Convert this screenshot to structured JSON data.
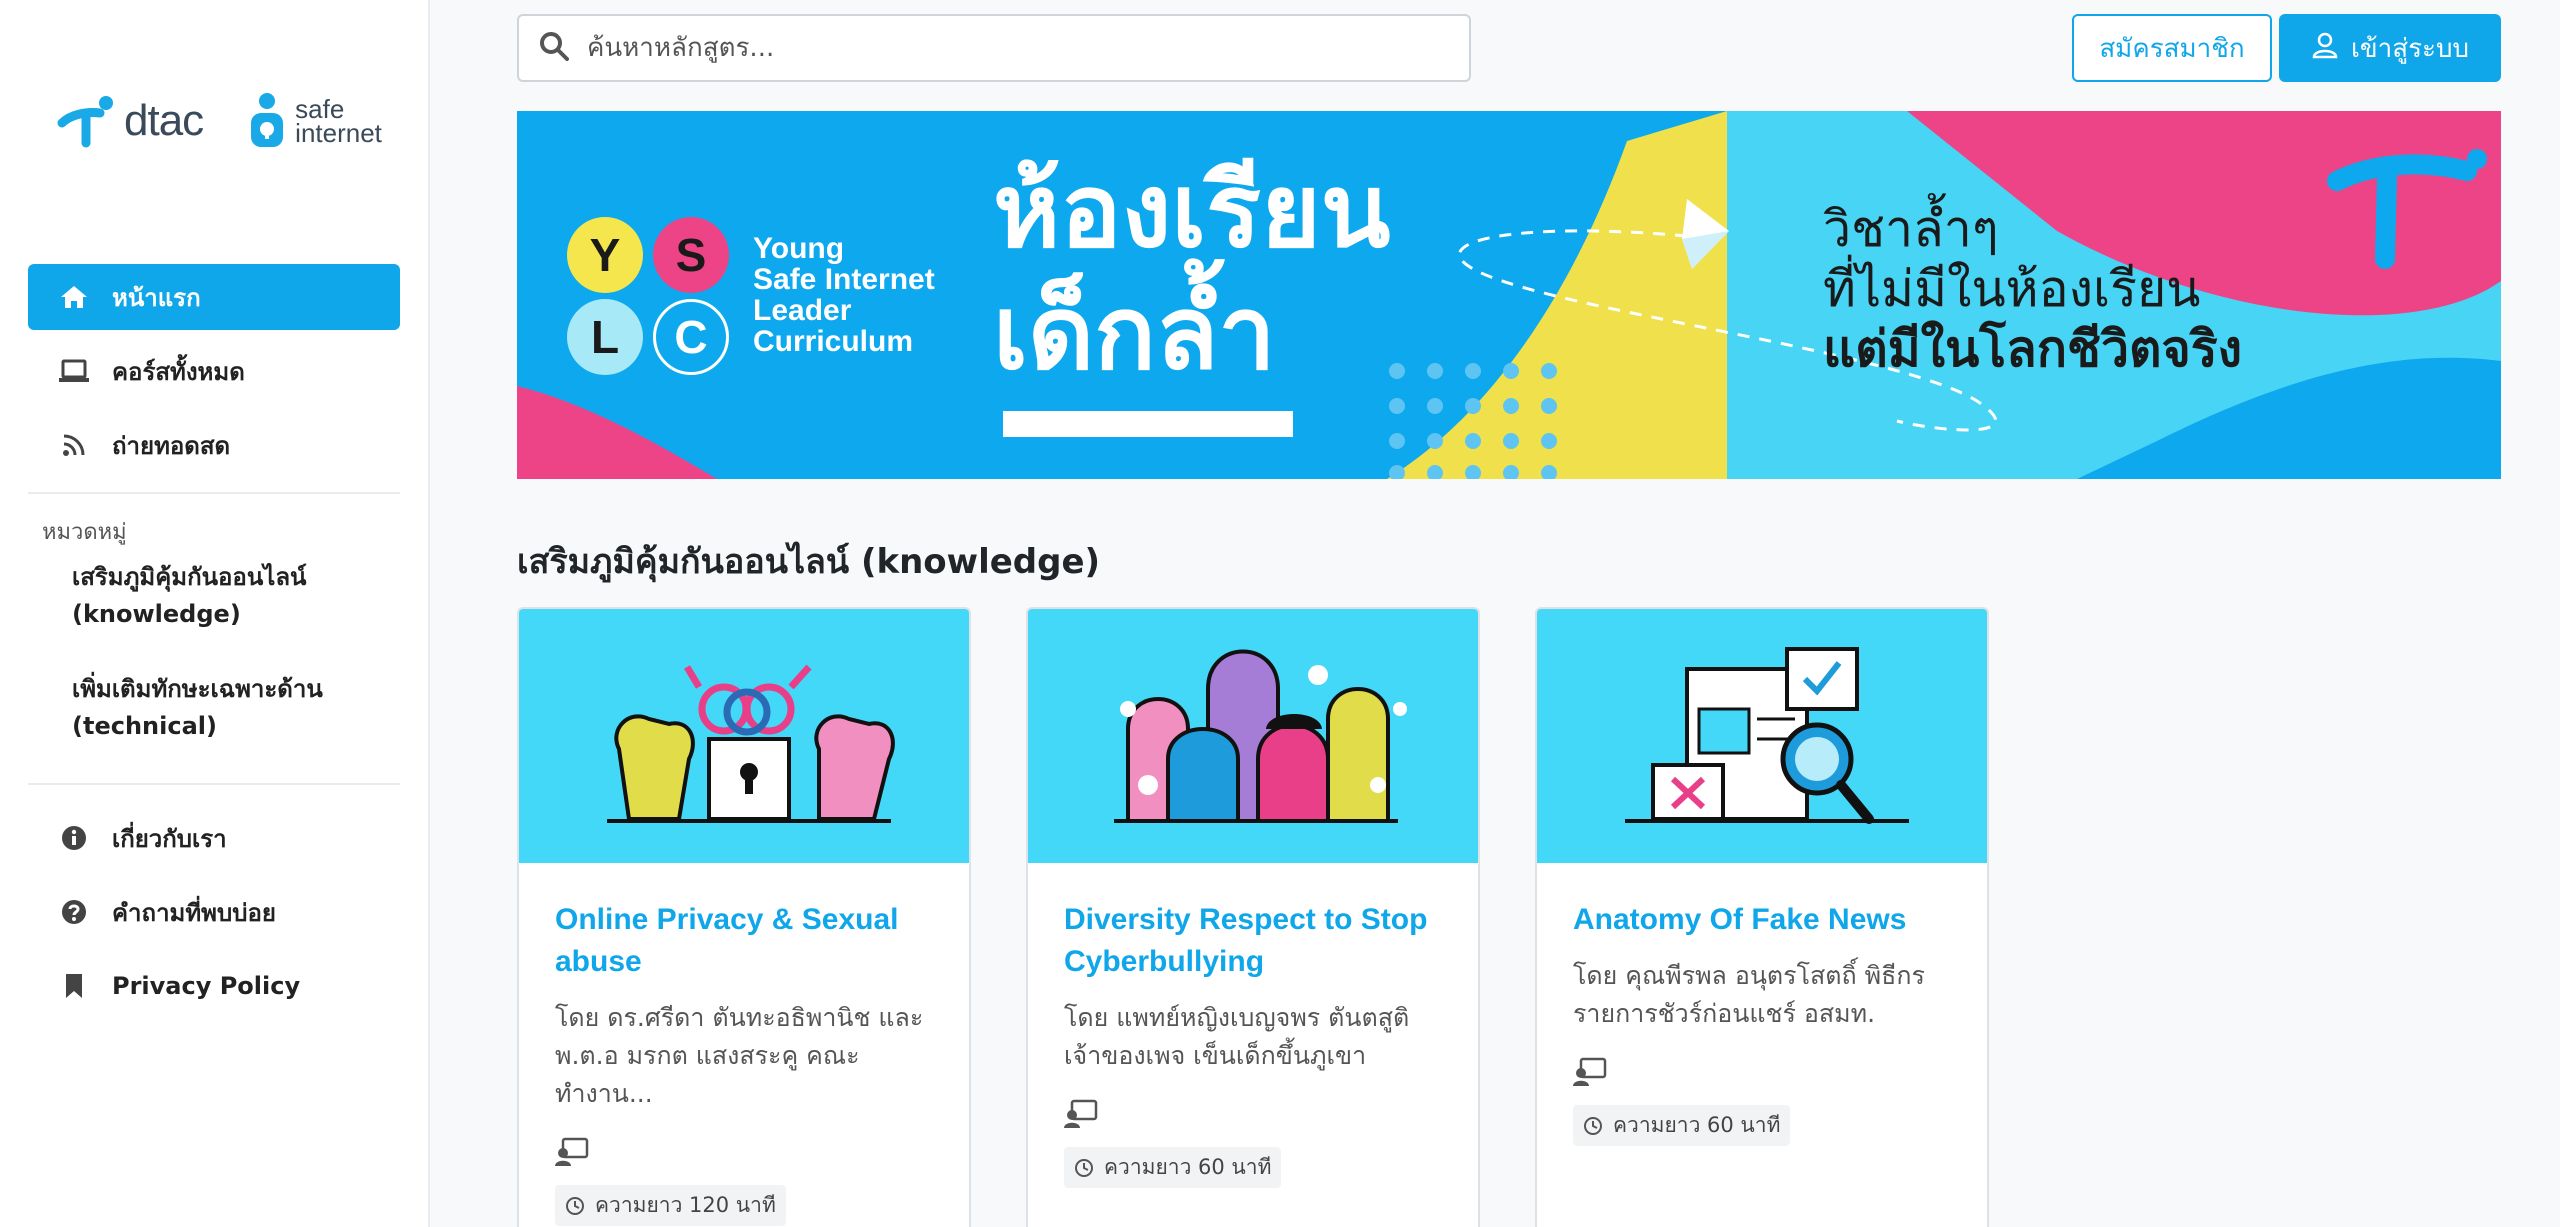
{
  "brand": {
    "dtac": "dtac",
    "safe_line1": "safe",
    "safe_line2": "internet",
    "accent": "#10a6ea"
  },
  "sidebar": {
    "nav": [
      {
        "label": "หน้าแรก",
        "icon": "home-icon",
        "active": true
      },
      {
        "label": "คอร์สทั้งหมด",
        "icon": "laptop-icon"
      },
      {
        "label": "ถ่ายทอดสด",
        "icon": "rss-icon"
      }
    ],
    "categories_title": "หมวดหมู่",
    "categories": [
      {
        "line1": "เสริมภูมิคุ้มกันออนไลน์",
        "line2": "(knowledge)"
      },
      {
        "line1": "เพิ่มเติมทักษะเฉพาะด้าน",
        "line2": "(technical)"
      }
    ],
    "footer_nav": [
      {
        "label": "เกี่ยวกับเรา",
        "icon": "info-icon"
      },
      {
        "label": "คำถามที่พบบ่อย",
        "icon": "question-icon"
      },
      {
        "label": "Privacy Policy",
        "icon": "bookmark-icon"
      }
    ]
  },
  "header": {
    "search_placeholder": "ค้นหาหลักสูตร...",
    "register_label": "สมัครสมาชิก",
    "login_label": "เข้าสู่ระบบ"
  },
  "banner": {
    "letters": [
      "Y",
      "S",
      "L",
      "C"
    ],
    "program_lines": [
      "Young",
      "Safe Internet",
      "Leader",
      "Curriculum"
    ],
    "headline_line1": "ห้องเรียน",
    "headline_line2": "เด็กล้ำ",
    "tagline_line1": "วิชาล้ำๆ",
    "tagline_line2": "ที่ไม่มีในห้องเรียน",
    "tagline_line3": "แต่มีในโลกชีวิตจริง"
  },
  "section": {
    "title": "เสริมภูมิคุ้มกันออนไลน์ (knowledge)"
  },
  "courses": [
    {
      "title_line1": "Online Privacy & Sexual",
      "title_line2": "abuse",
      "desc_line1": "โดย ดร.ศรีดา ตันทะอธิพานิช และ",
      "desc_line2": "พ.ต.อ มรกต แสงสระคู คณะทำงาน...",
      "duration": "ความยาว 120 นาที",
      "illustration": "privacy-lock-illustration"
    },
    {
      "title_line1": "Diversity Respect to Stop",
      "title_line2": "Cyberbullying",
      "desc_line1": "โดย แพทย์หญิงเบญจพร ตันตสูติ",
      "desc_line2": "เจ้าของเพจ เข็นเด็กขึ้นภูเขา",
      "duration": "ความยาว 60 นาที",
      "illustration": "diverse-people-illustration"
    },
    {
      "title_line1": "Anatomy Of Fake News",
      "title_line2": "",
      "desc_line1": "โดย คุณพีรพล อนุตรโสตถิ์ พิธีกร",
      "desc_line2": "รายการชัวร์ก่อนแชร์ อสมท.",
      "duration": "ความยาว 60 นาที",
      "illustration": "fake-news-magnifier-illustration"
    }
  ]
}
